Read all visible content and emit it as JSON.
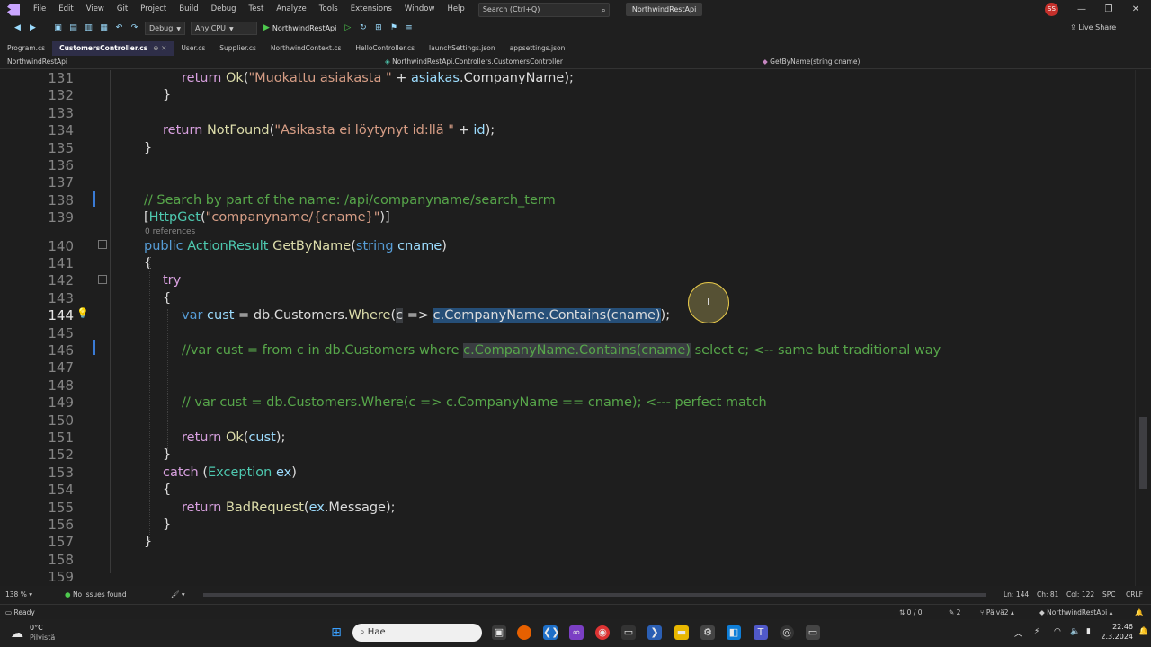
{
  "menu": [
    "File",
    "Edit",
    "View",
    "Git",
    "Project",
    "Build",
    "Debug",
    "Test",
    "Analyze",
    "Tools",
    "Extensions",
    "Window",
    "Help"
  ],
  "search_placeholder": "Search (Ctrl+Q)",
  "project_badge": "NorthwindRestApi",
  "avatar": "SS",
  "toolbar": {
    "config": "Debug",
    "platform": "Any CPU",
    "run_target": "NorthwindRestApi",
    "live_share": "Live Share"
  },
  "tabs": [
    {
      "label": "Program.cs",
      "active": false
    },
    {
      "label": "CustomersController.cs",
      "active": true
    },
    {
      "label": "User.cs",
      "active": false
    },
    {
      "label": "Supplier.cs",
      "active": false
    },
    {
      "label": "NorthwindContext.cs",
      "active": false
    },
    {
      "label": "HelloController.cs",
      "active": false
    },
    {
      "label": "launchSettings.json",
      "active": false
    },
    {
      "label": "appsettings.json",
      "active": false
    }
  ],
  "navbar": {
    "project": "NorthwindRestApi",
    "class": "NorthwindRestApi.Controllers.CustomersController",
    "member": "GetByName(string cname)"
  },
  "editor": {
    "current_line": 144,
    "references_text": "0 references",
    "lines": [
      {
        "n": "131",
        "tokens": [
          [
            "ctl",
            "return "
          ],
          [
            "fn",
            "Ok"
          ],
          [
            "plain",
            "("
          ],
          [
            "str",
            "\"Muokattu asiakasta \""
          ],
          [
            "plain",
            " + "
          ],
          [
            "id",
            "asiakas"
          ],
          [
            "plain",
            ".CompanyName);"
          ]
        ]
      },
      {
        "n": "132",
        "tokens": [
          [
            "plain",
            "}"
          ]
        ]
      },
      {
        "n": "133",
        "tokens": []
      },
      {
        "n": "134",
        "tokens": [
          [
            "ctl",
            "return "
          ],
          [
            "fn",
            "NotFound"
          ],
          [
            "plain",
            "("
          ],
          [
            "str",
            "\"Asikasta ei löytynyt id:llä \""
          ],
          [
            "plain",
            " + "
          ],
          [
            "id",
            "id"
          ],
          [
            "plain",
            ");"
          ]
        ]
      },
      {
        "n": "135",
        "tokens": [
          [
            "plain",
            "}"
          ]
        ]
      },
      {
        "n": "136",
        "tokens": []
      },
      {
        "n": "137",
        "tokens": []
      },
      {
        "n": "138",
        "tokens": [
          [
            "cmt",
            "// Search by part of the name: /api/companyname/search_term"
          ]
        ]
      },
      {
        "n": "139",
        "tokens": [
          [
            "plain",
            "["
          ],
          [
            "typ",
            "HttpGet"
          ],
          [
            "plain",
            "("
          ],
          [
            "str",
            "\"companyname/{cname}\""
          ],
          [
            "plain",
            ")]"
          ]
        ]
      },
      {
        "n": "140",
        "tokens": [
          [
            "kw",
            "public "
          ],
          [
            "typ",
            "ActionResult "
          ],
          [
            "fn",
            "GetByName"
          ],
          [
            "plain",
            "("
          ],
          [
            "kw",
            "string "
          ],
          [
            "id",
            "cname"
          ],
          [
            "plain",
            ")"
          ]
        ]
      },
      {
        "n": "141",
        "tokens": [
          [
            "plain",
            "{"
          ]
        ]
      },
      {
        "n": "142",
        "tokens": [
          [
            "ctl",
            "try"
          ]
        ]
      },
      {
        "n": "143",
        "tokens": [
          [
            "plain",
            "{"
          ]
        ]
      },
      {
        "n": "144",
        "tokens": [
          [
            "kw",
            "var "
          ],
          [
            "id",
            "cust"
          ],
          [
            "plain",
            " = db.Customers."
          ],
          [
            "fn",
            "Where"
          ],
          [
            "plain",
            "("
          ],
          [
            "hl",
            "c"
          ],
          [
            "plain",
            " => "
          ],
          [
            "sel",
            "c.CompanyName.Contains(cname)"
          ],
          [
            "plain",
            ");"
          ]
        ]
      },
      {
        "n": "145",
        "tokens": []
      },
      {
        "n": "146",
        "tokens": [
          [
            "cmt",
            "//var cust = from c in db.Customers where "
          ],
          [
            "cmtsel",
            "c.CompanyName.Contains(cname)"
          ],
          [
            "cmt",
            " select c; <-- same but traditional way"
          ]
        ]
      },
      {
        "n": "147",
        "tokens": []
      },
      {
        "n": "148",
        "tokens": []
      },
      {
        "n": "149",
        "tokens": [
          [
            "cmt",
            "// var cust = db.Customers.Where(c => c.CompanyName == cname); <--- perfect match"
          ]
        ]
      },
      {
        "n": "150",
        "tokens": []
      },
      {
        "n": "151",
        "tokens": [
          [
            "ctl",
            "return "
          ],
          [
            "fn",
            "Ok"
          ],
          [
            "plain",
            "("
          ],
          [
            "id",
            "cust"
          ],
          [
            "plain",
            ");"
          ]
        ]
      },
      {
        "n": "152",
        "tokens": [
          [
            "plain",
            "}"
          ]
        ]
      },
      {
        "n": "153",
        "tokens": [
          [
            "ctl",
            "catch "
          ],
          [
            "plain",
            "("
          ],
          [
            "typ",
            "Exception "
          ],
          [
            "id",
            "ex"
          ],
          [
            "plain",
            ")"
          ]
        ]
      },
      {
        "n": "154",
        "tokens": [
          [
            "plain",
            "{"
          ]
        ]
      },
      {
        "n": "155",
        "tokens": [
          [
            "ctl",
            "return "
          ],
          [
            "fn",
            "BadRequest"
          ],
          [
            "plain",
            "("
          ],
          [
            "id",
            "ex"
          ],
          [
            "plain",
            ".Message);"
          ]
        ]
      },
      {
        "n": "156",
        "tokens": [
          [
            "plain",
            "}"
          ]
        ]
      },
      {
        "n": "157",
        "tokens": [
          [
            "plain",
            "}"
          ]
        ]
      },
      {
        "n": "158",
        "tokens": []
      },
      {
        "n": "159",
        "tokens": []
      }
    ]
  },
  "editbar": {
    "zoom": "138 %",
    "issues": "No issues found",
    "ln": "Ln: 144",
    "ch": "Ch: 81",
    "col": "Col: 122",
    "spc": "SPC",
    "crlf": "CRLF"
  },
  "statusbar": {
    "ready": "Ready",
    "git_counts": "0 / 0",
    "pencil": "2",
    "branch": "Päivä2",
    "project": "NorthwindRestApi"
  },
  "taskbar": {
    "weather_temp": "0°C",
    "weather_desc": "Pilvistä",
    "search": "Hae",
    "time": "22.46",
    "date": "2.3.2024"
  },
  "colors": {
    "accent": "#8d7bf0",
    "selection": "#264f78"
  }
}
